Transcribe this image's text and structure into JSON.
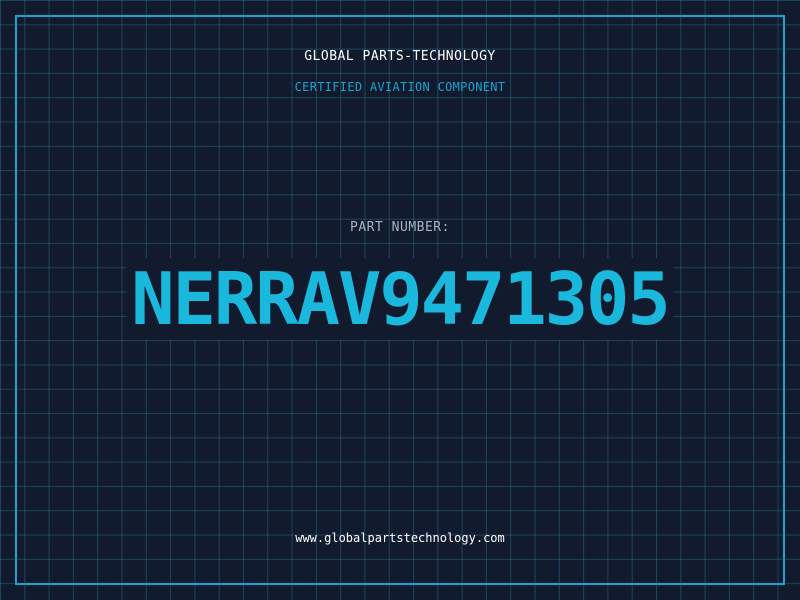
{
  "header": {
    "company": "GLOBAL PARTS-TECHNOLOGY",
    "subtitle": "CERTIFIED AVIATION COMPONENT"
  },
  "part": {
    "label": "PART NUMBER:",
    "number": "NERRAV9471305"
  },
  "footer": {
    "website": "www.globalpartstechnology.com"
  },
  "colors": {
    "background": "#121a2e",
    "accent": "#1ab8dd",
    "grid": "#287896"
  }
}
